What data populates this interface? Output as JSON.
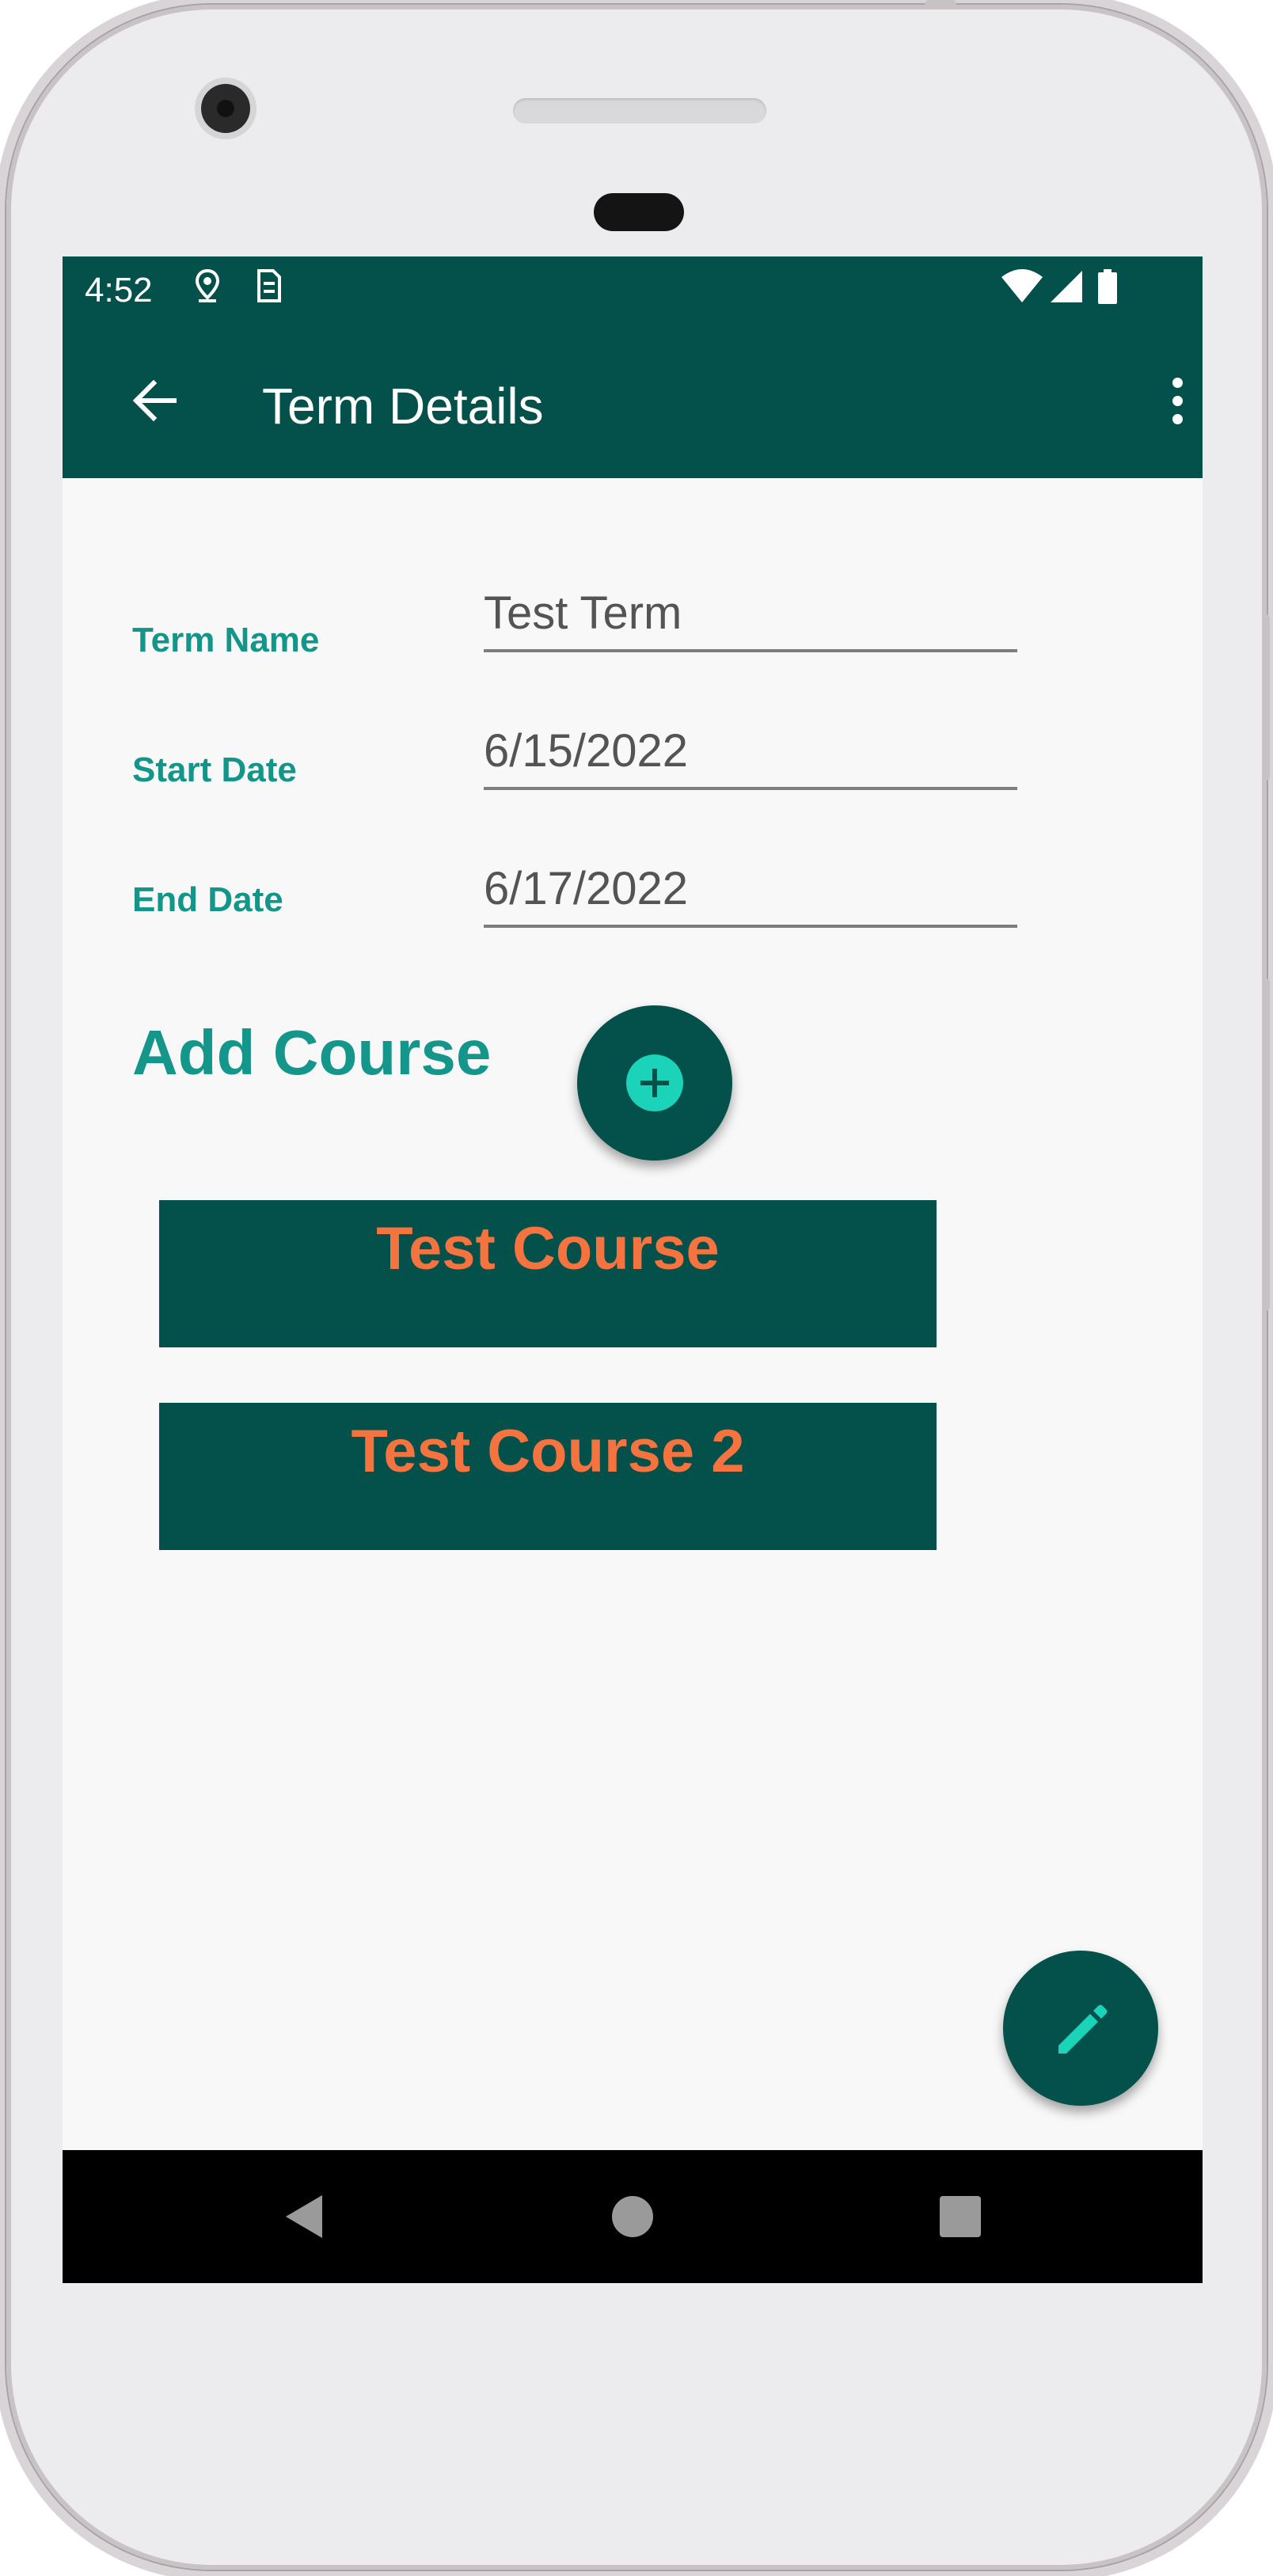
{
  "status_bar": {
    "time": "4:52",
    "icons": [
      "location-pin-icon",
      "sim-icon",
      "wifi-icon",
      "signal-icon",
      "battery-icon"
    ]
  },
  "app_bar": {
    "title": "Term Details",
    "back_icon": "arrow-left-icon",
    "menu_icon": "more-vertical-icon"
  },
  "form": {
    "term_name_label": "Term Name",
    "term_name_value": "Test Term",
    "start_date_label": "Start Date",
    "start_date_value": "6/15/2022",
    "end_date_label": "End Date",
    "end_date_value": "6/17/2022"
  },
  "add_course": {
    "label": "Add Course",
    "icon": "plus-circle-icon"
  },
  "courses": [
    {
      "title": "Test Course"
    },
    {
      "title": "Test Course 2"
    }
  ],
  "edit_fab": {
    "icon": "pencil-icon"
  },
  "nav_bar": {
    "icons": [
      "back-triangle-icon",
      "home-circle-icon",
      "recents-square-icon"
    ]
  },
  "colors": {
    "primary": "#03514a",
    "label": "#12968a",
    "course_text": "#f4733f",
    "accent": "#1bd3b9",
    "background": "#f8f8f8"
  }
}
